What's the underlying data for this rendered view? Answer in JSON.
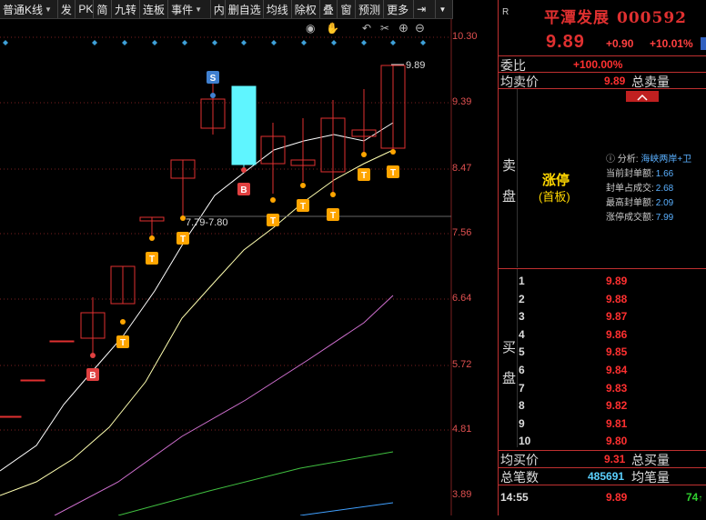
{
  "toolbar": {
    "items": [
      {
        "label": "普通K线",
        "caret": true
      },
      {
        "label": "发"
      },
      {
        "label": "PK"
      },
      {
        "label": "简"
      },
      {
        "label": "九转"
      },
      {
        "label": "连板"
      },
      {
        "label": "事件",
        "caret": true
      },
      {
        "label": "内"
      },
      {
        "label": "删自选"
      },
      {
        "label": "均线"
      },
      {
        "label": "除权"
      },
      {
        "label": "叠"
      },
      {
        "label": "窗"
      },
      {
        "label": "预测"
      },
      {
        "label": "更多"
      }
    ]
  },
  "chart_data": {
    "type": "candlestick",
    "price_axis": [
      "10.30",
      "9.39",
      "8.47",
      "7.56",
      "6.64",
      "5.72",
      "4.81",
      "3.89"
    ],
    "high_annotation": "9.89",
    "range_annotation": "7.79-7.80",
    "signals": [
      {
        "label": "S"
      },
      {
        "label": "B"
      },
      {
        "label": "B"
      },
      {
        "label": "T"
      },
      {
        "label": "T"
      },
      {
        "label": "T"
      },
      {
        "label": "T"
      },
      {
        "label": "T"
      },
      {
        "label": "T"
      },
      {
        "label": "T"
      },
      {
        "label": "T"
      }
    ],
    "colors": {
      "up": "#e03030",
      "limit_candle": "#5ff5ff",
      "ma5": "#ffffff",
      "ma10": "#ffffb0",
      "ma20": "#d070d0",
      "ma60": "#40c040",
      "ma120": "#40a0ff",
      "signal_t": "#ffa500",
      "signal_b": "#e04040",
      "signal_s": "#4080d0"
    }
  },
  "chart_icons": [
    "eye-icon",
    "hand-icon",
    "undo-icon",
    "scissors-icon",
    "zoom-in-icon",
    "zoom-out-icon"
  ],
  "quote": {
    "r_label": "R",
    "name": "平潭发展",
    "code": "000592",
    "price": "9.89",
    "change": "+0.90",
    "change_pct": "+10.01%",
    "weibi_label": "委比",
    "weibi_value": "+100.00%",
    "sell_avg_label": "均卖价",
    "sell_avg_value": "9.89",
    "sell_total_label": "总卖量",
    "sell_side_label": [
      "卖",
      "盘"
    ],
    "limit_up": "涨停",
    "limit_up_sub": "(首板)",
    "analysis_label": "分析:",
    "analysis_value": "海峡两岸+卫",
    "info": [
      {
        "label": "当前封单额:",
        "value": "1.66"
      },
      {
        "label": "封单占成交:",
        "value": "2.68"
      },
      {
        "label": "最高封单额:",
        "value": "2.09"
      },
      {
        "label": "涨停成交额:",
        "value": "7.99"
      }
    ],
    "buy_side_label": [
      "买",
      "盘"
    ],
    "bids": [
      {
        "idx": "1",
        "price": "9.89"
      },
      {
        "idx": "2",
        "price": "9.88"
      },
      {
        "idx": "3",
        "price": "9.87"
      },
      {
        "idx": "4",
        "price": "9.86"
      },
      {
        "idx": "5",
        "price": "9.85"
      },
      {
        "idx": "6",
        "price": "9.84"
      },
      {
        "idx": "7",
        "price": "9.83"
      },
      {
        "idx": "8",
        "price": "9.82"
      },
      {
        "idx": "9",
        "price": "9.81"
      },
      {
        "idx": "10",
        "price": "9.80"
      }
    ],
    "buy_avg_label": "均买价",
    "buy_avg_value": "9.31",
    "buy_total_label": "总买量",
    "total_trades_label": "总笔数",
    "total_trades_value": "485691",
    "avg_trade_label": "均笔量",
    "tick_time": "14:55",
    "tick_price": "9.89",
    "tick_vol": "74"
  }
}
